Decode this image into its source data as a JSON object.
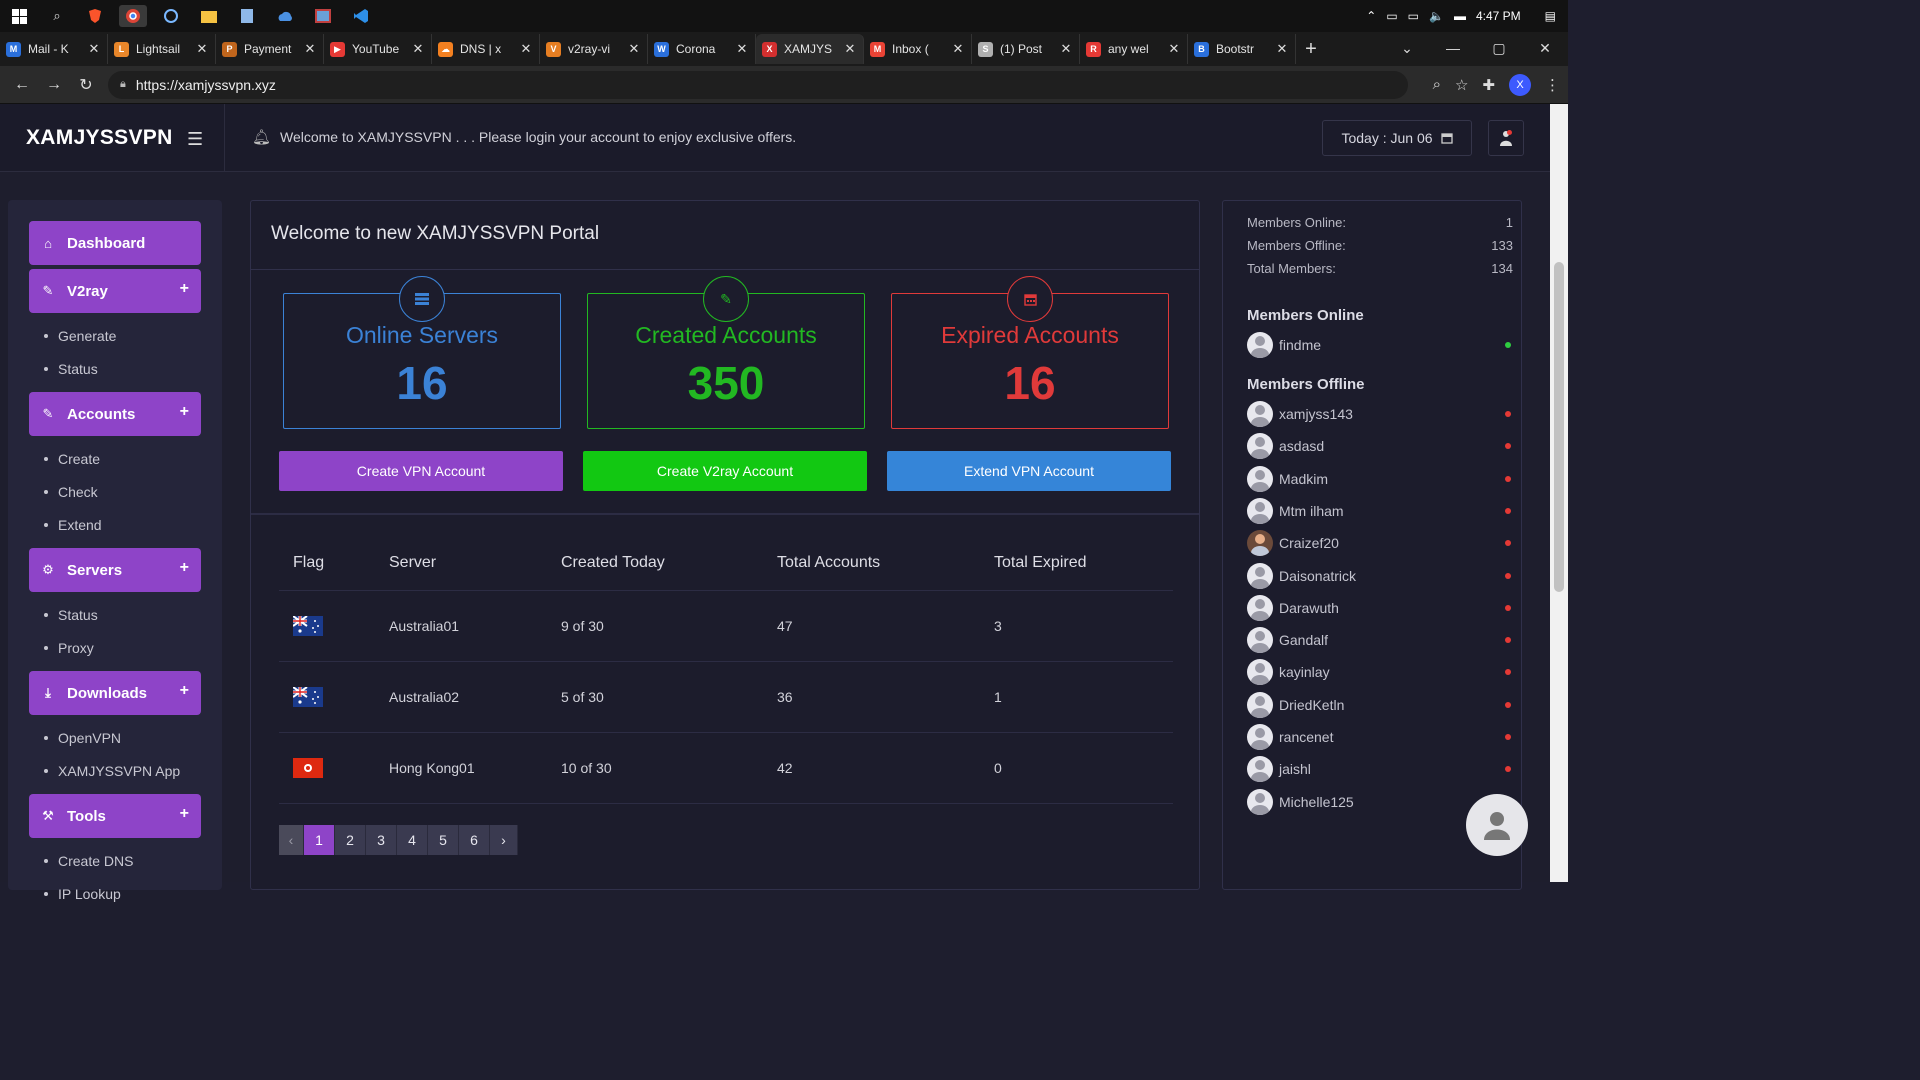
{
  "taskbar": {
    "icons": [
      "windows-start-icon",
      "search-icon",
      "brave-icon",
      "chrome-icon",
      "cortana-icon",
      "file-explorer-icon",
      "notepad-icon",
      "cloud-icon",
      "photos-icon",
      "vscode-icon"
    ],
    "time": "4:47 PM"
  },
  "tabs": [
    {
      "title": "Mail - K",
      "color": "#2a6fdb",
      "glyph": "M"
    },
    {
      "title": "Lightsail",
      "color": "#e8862a",
      "glyph": "L"
    },
    {
      "title": "Payment",
      "color": "#c0651c",
      "glyph": "P"
    },
    {
      "title": "YouTube",
      "color": "#e53935",
      "glyph": "▶"
    },
    {
      "title": "DNS | x",
      "color": "#f38020",
      "glyph": "☁"
    },
    {
      "title": "v2ray-vi",
      "color": "#e67e22",
      "glyph": "V"
    },
    {
      "title": "Corona",
      "color": "#2a6fdb",
      "glyph": "W"
    },
    {
      "title": "XAMJYS",
      "color": "#d32f2f",
      "glyph": "X"
    },
    {
      "title": "Inbox (",
      "color": "#ea4335",
      "glyph": "M"
    },
    {
      "title": "(1) Post",
      "color": "#b0b0b0",
      "glyph": "S"
    },
    {
      "title": "any wel",
      "color": "#e53935",
      "glyph": "R"
    },
    {
      "title": "Bootstr",
      "color": "#2a6fdb",
      "glyph": "B"
    }
  ],
  "browser": {
    "url": "https://xamjyssvpn.xyz",
    "profile_initial": "X"
  },
  "header": {
    "brand": "XAMJYSSVPN",
    "welcome": "Welcome to XAMJYSSVPN . . . Please login your account to enjoy exclusive offers.",
    "today": "Today : Jun 06"
  },
  "sidebar": {
    "sections": [
      {
        "label": "Dashboard",
        "icon": "home-icon",
        "items": []
      },
      {
        "label": "V2ray",
        "icon": "pencil-icon",
        "items": [
          "Generate",
          "Status"
        ]
      },
      {
        "label": "Accounts",
        "icon": "pencil-icon",
        "items": [
          "Create",
          "Check",
          "Extend"
        ]
      },
      {
        "label": "Servers",
        "icon": "gear-icon",
        "items": [
          "Status",
          "Proxy"
        ]
      },
      {
        "label": "Downloads",
        "icon": "download-icon",
        "items": [
          "OpenVPN",
          "XAMJYSSVPN App"
        ]
      },
      {
        "label": "Tools",
        "icon": "tools-icon",
        "items": [
          "Create DNS",
          "IP Lookup"
        ]
      }
    ]
  },
  "main": {
    "title": "Welcome to new XAMJYSSVPN Portal",
    "stats": [
      {
        "label": "Online Servers",
        "value": "16",
        "color": "#3b82d6",
        "icon": "server-icon"
      },
      {
        "label": "Created Accounts",
        "value": "350",
        "color": "#22b822",
        "icon": "pencil-icon"
      },
      {
        "label": "Expired Accounts",
        "value": "16",
        "color": "#e03a3a",
        "icon": "calendar-icon"
      }
    ],
    "actions": [
      {
        "label": "Create VPN Account",
        "color": "#8e44c8"
      },
      {
        "label": "Create V2ray Account",
        "color": "#12c812"
      },
      {
        "label": "Extend VPN Account",
        "color": "#3585d8"
      }
    ],
    "table": {
      "headers": [
        "Flag",
        "Server",
        "Created Today",
        "Total Accounts",
        "Total Expired"
      ],
      "rows": [
        {
          "flag": "australia-flag",
          "server": "Australia01",
          "created_today": "9 of 30",
          "total_accounts": "47",
          "total_expired": "3"
        },
        {
          "flag": "australia-flag",
          "server": "Australia02",
          "created_today": "5 of 30",
          "total_accounts": "36",
          "total_expired": "1"
        },
        {
          "flag": "hong-kong-flag",
          "server": "Hong Kong01",
          "created_today": "10 of 30",
          "total_accounts": "42",
          "total_expired": "0"
        }
      ]
    },
    "pagination": {
      "prev": "‹",
      "pages": [
        "1",
        "2",
        "3",
        "4",
        "5",
        "6"
      ],
      "next": "›",
      "current": "1"
    }
  },
  "members": {
    "stats": [
      {
        "label": "Members Online:",
        "value": "1"
      },
      {
        "label": "Members Offline:",
        "value": "133"
      },
      {
        "label": "Total Members:",
        "value": "134"
      }
    ],
    "online_heading": "Members Online",
    "online": [
      "findme"
    ],
    "offline_heading": "Members Offline",
    "offline": [
      "xamjyss143",
      "asdasd",
      "Madkim",
      "Mtm ilham",
      "Craizef20",
      "Daisonatrick",
      "Darawuth",
      "Gandalf",
      "kayinlay",
      "DriedKetln",
      "rancenet",
      "jaishl",
      "Michelle125"
    ],
    "online_color": "#2ecc40",
    "offline_color": "#e53935"
  }
}
